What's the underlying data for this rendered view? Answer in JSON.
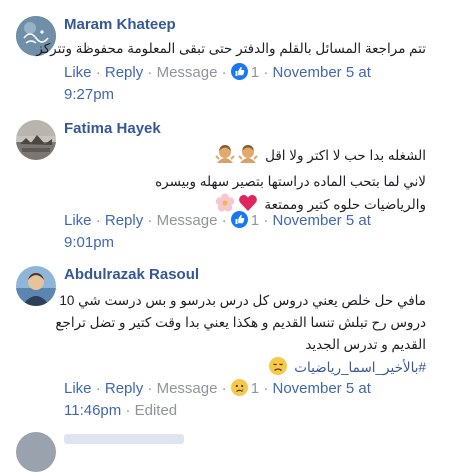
{
  "comments": [
    {
      "author": "Maram Khateep",
      "lines": [
        "تتم مراجعة المسائل بالقلم والدفتر حتى تبقى المعلومة محفوظة وتتركز"
      ],
      "actions": {
        "like": "Like",
        "dot1": "·",
        "reply": "Reply",
        "dot2": "·",
        "message": "Message",
        "dot3": "·",
        "reaction_count": "1",
        "dot4": "·",
        "date": "November 5 at",
        "time": "9:27pm"
      },
      "reaction_icon": "like-icon"
    },
    {
      "author": "Fatima Hayek",
      "lines": [
        "الشغله بدا حب لا اكتر ولا اقل",
        "لاني لما بتحب الماده دراستها بتصير سهله وبيسره",
        "والرياضيات حلوه كتير وممتعة"
      ],
      "emojis": [
        "person-shrugging-emoji",
        "heart-emoji",
        "blossom-emoji"
      ],
      "actions": {
        "like": "Like",
        "dot1": "·",
        "reply": "Reply",
        "dot2": "·",
        "message": "Message",
        "dot3": "·",
        "reaction_count": "1",
        "dot4": "·",
        "date": "November 5 at",
        "time": "9:01pm"
      },
      "reaction_icon": "like-icon"
    },
    {
      "author": "Abdulrazak Rasoul",
      "lines": [
        "مافي حل خلص يعني دروس كل درس بدرسو و بس درست شي 10",
        "دروس رح تبلش تنسا القديم و هكذا يعني بدا وقت كتير و تضل تراجع",
        "القديم و تدرس الجديد",
        "#بالأخير_اسما_رياضيات"
      ],
      "emojis": [
        "disappointed-face-emoji"
      ],
      "actions": {
        "like": "Like",
        "dot1": "·",
        "reply": "Reply",
        "dot2": "·",
        "message": "Message",
        "dot3": "·",
        "reaction_count": "1",
        "dot4": "·",
        "date": "November 5 at",
        "time": "11:46pm",
        "dot5": "·",
        "edited": "Edited"
      },
      "reaction_icon": "sad-face-icon"
    }
  ],
  "colors": {
    "author": "#365899",
    "link": "#4267b2",
    "muted": "#90949c",
    "like": "#1877f2"
  }
}
